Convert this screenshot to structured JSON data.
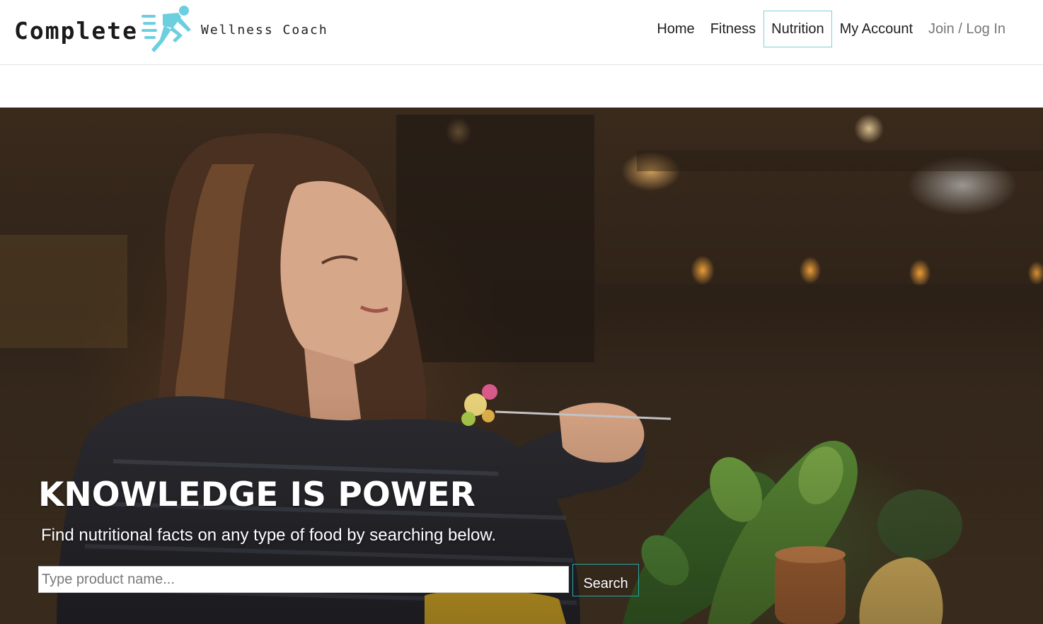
{
  "logo": {
    "main_text": "Complete",
    "sub_text": "Wellness Coach",
    "icon": "running-man-icon",
    "accent_color": "#6ccfe0"
  },
  "nav": {
    "items": [
      {
        "label": "Home"
      },
      {
        "label": "Fitness"
      },
      {
        "label": "Nutrition",
        "active": true
      },
      {
        "label": "My Account"
      },
      {
        "label": "Join / Log In"
      }
    ],
    "active_border_color": "#7fd1d6"
  },
  "hero": {
    "title": "KNOWLEDGE IS POWER",
    "subtitle": "Find nutritional facts on any type of food by searching below.",
    "search": {
      "placeholder": "Type product name...",
      "value": "",
      "button_label": "Search"
    },
    "button_border_color": "#2aa6a6"
  }
}
